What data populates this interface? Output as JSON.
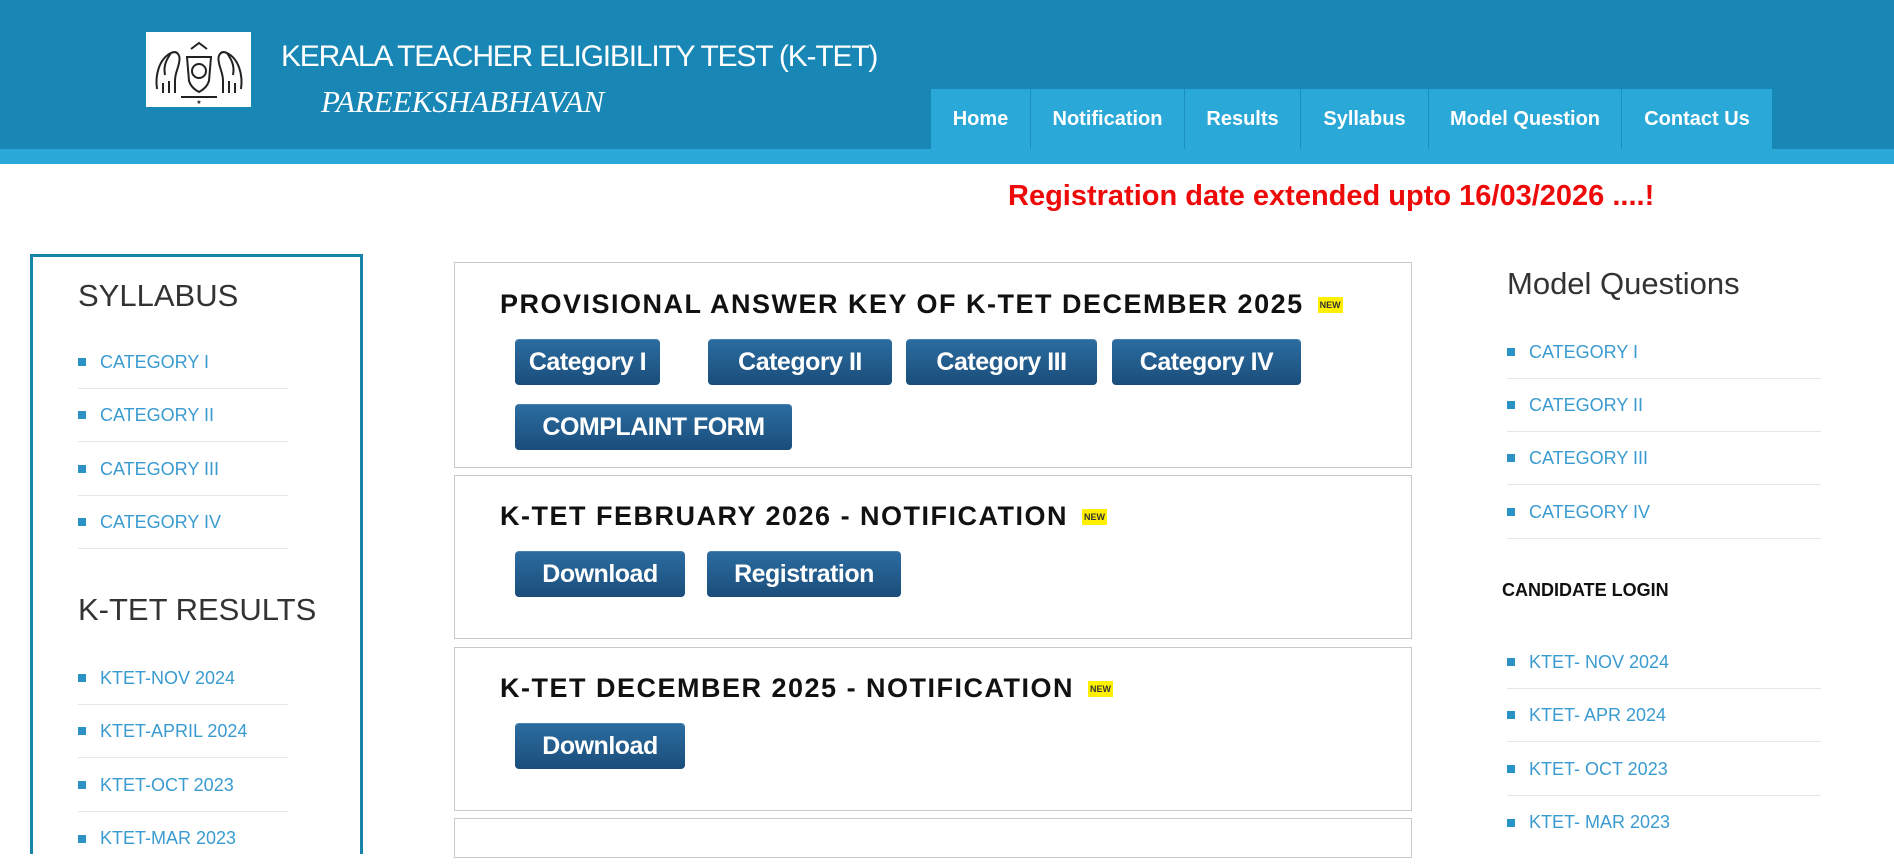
{
  "header": {
    "title": "KERALA TEACHER ELIGIBILITY TEST (K-TET)",
    "subtitle": "PAREEKSHABHAVAN",
    "logo_icon": "kerala-emblem-icon",
    "colors": {
      "header_bg": "#1887b5",
      "nav_bg": "#2aa8d8"
    }
  },
  "nav": [
    {
      "label": "Home"
    },
    {
      "label": "Notification"
    },
    {
      "label": "Results"
    },
    {
      "label": "Syllabus"
    },
    {
      "label": "Model Question"
    },
    {
      "label": "Contact Us"
    }
  ],
  "announcement": "Registration date extended upto 16/03/2026 ....!",
  "left": {
    "syllabus_heading": "SYLLABUS",
    "syllabus_items": [
      "CATEGORY I",
      "CATEGORY II",
      "CATEGORY III",
      "CATEGORY IV"
    ],
    "results_heading": "K-TET RESULTS",
    "results_items": [
      "KTET-NOV 2024",
      "KTET-APRIL 2024",
      "KTET-OCT 2023",
      "KTET-MAR 2023"
    ]
  },
  "panels": [
    {
      "title": "PROVISIONAL ANSWER KEY OF K-TET DECEMBER 2025",
      "badge": "NEW",
      "buttons": [
        "Category I",
        "Category II",
        "Category III",
        "Category IV",
        "COMPLAINT FORM"
      ]
    },
    {
      "title": "K-TET FEBRUARY 2026 - NOTIFICATION",
      "badge": "NEW",
      "buttons": [
        "Download",
        "Registration"
      ]
    },
    {
      "title": "K-TET DECEMBER 2025 - NOTIFICATION",
      "badge": "NEW",
      "buttons": [
        "Download"
      ]
    }
  ],
  "right": {
    "model_heading": "Model Questions",
    "model_items": [
      "CATEGORY I",
      "CATEGORY II",
      "CATEGORY III",
      "CATEGORY IV"
    ],
    "login_heading": "CANDIDATE LOGIN",
    "login_items": [
      "KTET- NOV 2024",
      "KTET- APR 2024",
      "KTET- OCT 2023",
      "KTET- MAR 2023"
    ]
  }
}
